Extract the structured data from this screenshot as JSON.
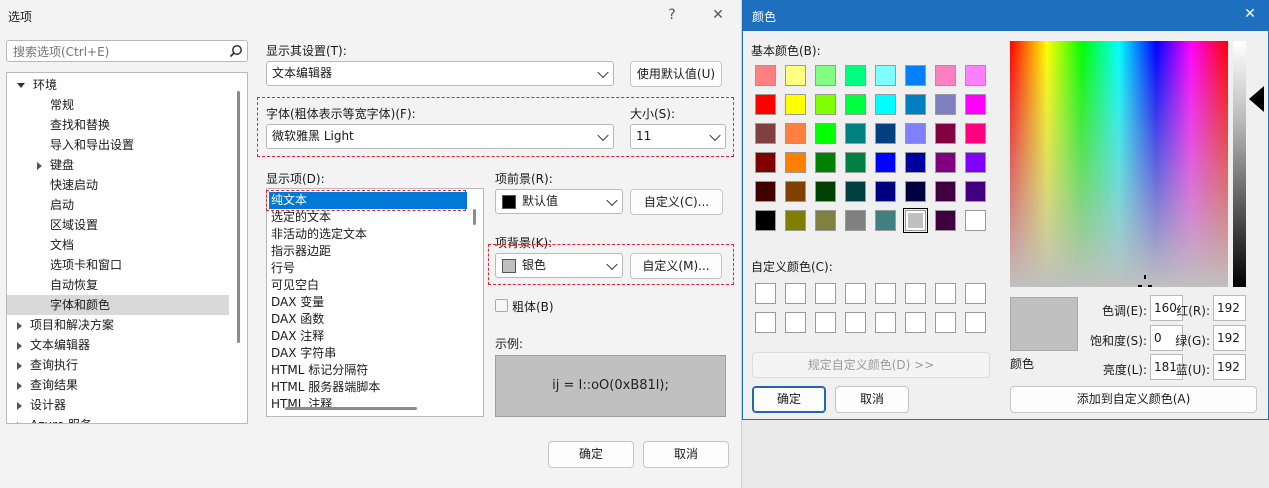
{
  "options": {
    "title": "选项",
    "help_glyph": "?",
    "close_glyph": "✕",
    "search": {
      "placeholder": "搜索选项(Ctrl+E)"
    },
    "tree": [
      {
        "label": "环境",
        "level": 0,
        "expander": "down"
      },
      {
        "label": "常规",
        "level": 1
      },
      {
        "label": "查找和替换",
        "level": 1
      },
      {
        "label": "导入和导出设置",
        "level": 1
      },
      {
        "label": "键盘",
        "level": 1,
        "expander": "right"
      },
      {
        "label": "快速启动",
        "level": 1
      },
      {
        "label": "启动",
        "level": 1
      },
      {
        "label": "区域设置",
        "level": 1
      },
      {
        "label": "文档",
        "level": 1
      },
      {
        "label": "选项卡和窗口",
        "level": 1
      },
      {
        "label": "自动恢复",
        "level": 1
      },
      {
        "label": "字体和颜色",
        "level": 1,
        "selected": true
      },
      {
        "label": "项目和解决方案",
        "level": 0,
        "expander": "right"
      },
      {
        "label": "文本编辑器",
        "level": 0,
        "expander": "right"
      },
      {
        "label": "查询执行",
        "level": 0,
        "expander": "right"
      },
      {
        "label": "查询结果",
        "level": 0,
        "expander": "right"
      },
      {
        "label": "设计器",
        "level": 0,
        "expander": "right"
      },
      {
        "label": "Azure 服务",
        "level": 0,
        "expander": "right"
      }
    ],
    "show_settings_label": "显示其设置(T):",
    "show_settings_value": "文本编辑器",
    "use_defaults_button": "使用默认值(U)",
    "font_label": "字体(粗体表示等宽字体)(F):",
    "font_value": "微软雅黑 Light",
    "size_label": "大小(S):",
    "size_value": "11",
    "display_items_label": "显示项(D):",
    "display_items": [
      "纯文本",
      "选定的文本",
      "非活动的选定文本",
      "指示器边距",
      "行号",
      "可见空白",
      "DAX 变量",
      "DAX 函数",
      "DAX 注释",
      "DAX 字符串",
      "HTML 标记分隔符",
      "HTML 服务器端脚本",
      "HTML 注释"
    ],
    "selected_item_index": 0,
    "foreground_label": "项前景(R):",
    "foreground_value": "默认值",
    "foreground_color": "#000000",
    "custom_fg_button": "自定义(C)...",
    "background_label": "项背景(K):",
    "background_value": "银色",
    "background_color": "#c0c0c0",
    "custom_bg_button": "自定义(M)...",
    "bold_label": "粗体(B)",
    "sample_label": "示例:",
    "sample_text": "ij = I::oO(0xB81l);",
    "ok_button": "确定",
    "cancel_button": "取消"
  },
  "color_dialog": {
    "title": "颜色",
    "close_glyph": "✕",
    "basic_colors_label": "基本颜色(B):",
    "basic_colors": [
      [
        "#ff8080",
        "#ffff80",
        "#80ff80",
        "#00ff80",
        "#80ffff",
        "#0080ff",
        "#ff80c0",
        "#ff80ff"
      ],
      [
        "#ff0000",
        "#ffff00",
        "#80ff00",
        "#00ff40",
        "#00ffff",
        "#0080c0",
        "#8080c0",
        "#ff00ff"
      ],
      [
        "#804040",
        "#ff8040",
        "#00ff00",
        "#008080",
        "#004080",
        "#8080ff",
        "#800040",
        "#ff0080"
      ],
      [
        "#800000",
        "#ff8000",
        "#008000",
        "#008040",
        "#0000ff",
        "#0000a0",
        "#800080",
        "#8000ff"
      ],
      [
        "#400000",
        "#804000",
        "#004000",
        "#004040",
        "#000080",
        "#000040",
        "#400040",
        "#400080"
      ],
      [
        "#000000",
        "#808000",
        "#808040",
        "#808080",
        "#408080",
        "#c0c0c0",
        "#400040",
        "#ffffff"
      ]
    ],
    "selected_basic": [
      5,
      5
    ],
    "custom_colors_label": "自定义颜色(C):",
    "define_custom_button": "规定自定义颜色(D) >>",
    "ok_button": "确定",
    "cancel_button": "取消",
    "preview_color": "#c0c0c0",
    "preview_label": "颜色",
    "hue_label": "色调(E):",
    "hue_value": "160",
    "sat_label": "饱和度(S):",
    "sat_value": "0",
    "lum_label": "亮度(L):",
    "lum_value": "181",
    "red_label": "红(R):",
    "red_value": "192",
    "green_label": "绿(G):",
    "green_value": "192",
    "blue_label": "蓝(U):",
    "blue_value": "192",
    "add_custom_button": "添加到自定义颜色(A)"
  }
}
